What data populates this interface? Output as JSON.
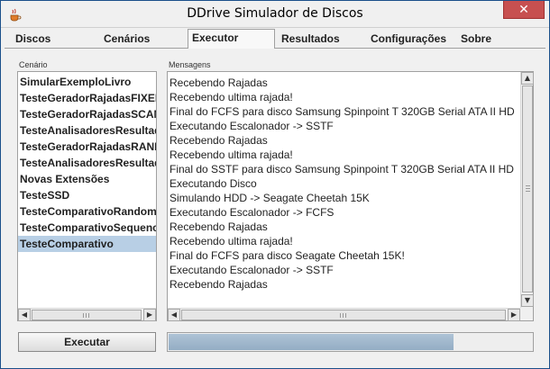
{
  "window": {
    "title": "DDrive Simulador de Discos",
    "close_glyph": "✕"
  },
  "tabs": [
    {
      "label": "Discos"
    },
    {
      "label": "Cenários"
    },
    {
      "label": "Executor"
    },
    {
      "label": "Resultados"
    },
    {
      "label": "Configurações"
    },
    {
      "label": "Sobre"
    }
  ],
  "active_tab": "Executor",
  "scenario_panel": {
    "label": "Cenário",
    "items": [
      "SimularExemploLivro",
      "TesteGeradorRajadasFIXED",
      "TesteGeradorRajadasSCAN",
      "TesteAnalisadoresResultado",
      "TesteGeradorRajadasRANDOM",
      "TesteAnalisadoresResultado",
      "Novas Extensões",
      "TesteSSD",
      "TesteComparativoRandom",
      "TesteComparativoSequencial",
      "TesteComparativo"
    ],
    "selected_index": 10
  },
  "messages_panel": {
    "label": "Mensagens",
    "lines": [
      "Recebendo Rajadas",
      "Recebendo ultima rajada!",
      "Final do FCFS para disco Samsung Spinpoint T 320GB Serial ATA II HD",
      "Executando Escalonador -> SSTF",
      "Recebendo Rajadas",
      "Recebendo ultima rajada!",
      "Final do SSTF para disco Samsung Spinpoint T 320GB Serial ATA II HD",
      "Executando Disco",
      "Simulando HDD  -> Seagate Cheetah 15K",
      "Executando Escalonador -> FCFS",
      "Recebendo Rajadas",
      "Recebendo ultima rajada!",
      "Final do FCFS para disco Seagate Cheetah 15K!",
      "Executando Escalonador -> SSTF",
      "Recebendo Rajadas"
    ]
  },
  "execute_button": {
    "label": "Executar"
  },
  "progress": {
    "fraction": 0.78
  },
  "colors": {
    "selection": "#b8cfe5",
    "progress_fill": "#9fb6cc",
    "close_button": "#c75050"
  },
  "icons": {
    "app": "java-coffee-cup-icon",
    "scroll_left": "◀",
    "scroll_right": "▶",
    "scroll_up": "▲",
    "scroll_down": "▼"
  }
}
